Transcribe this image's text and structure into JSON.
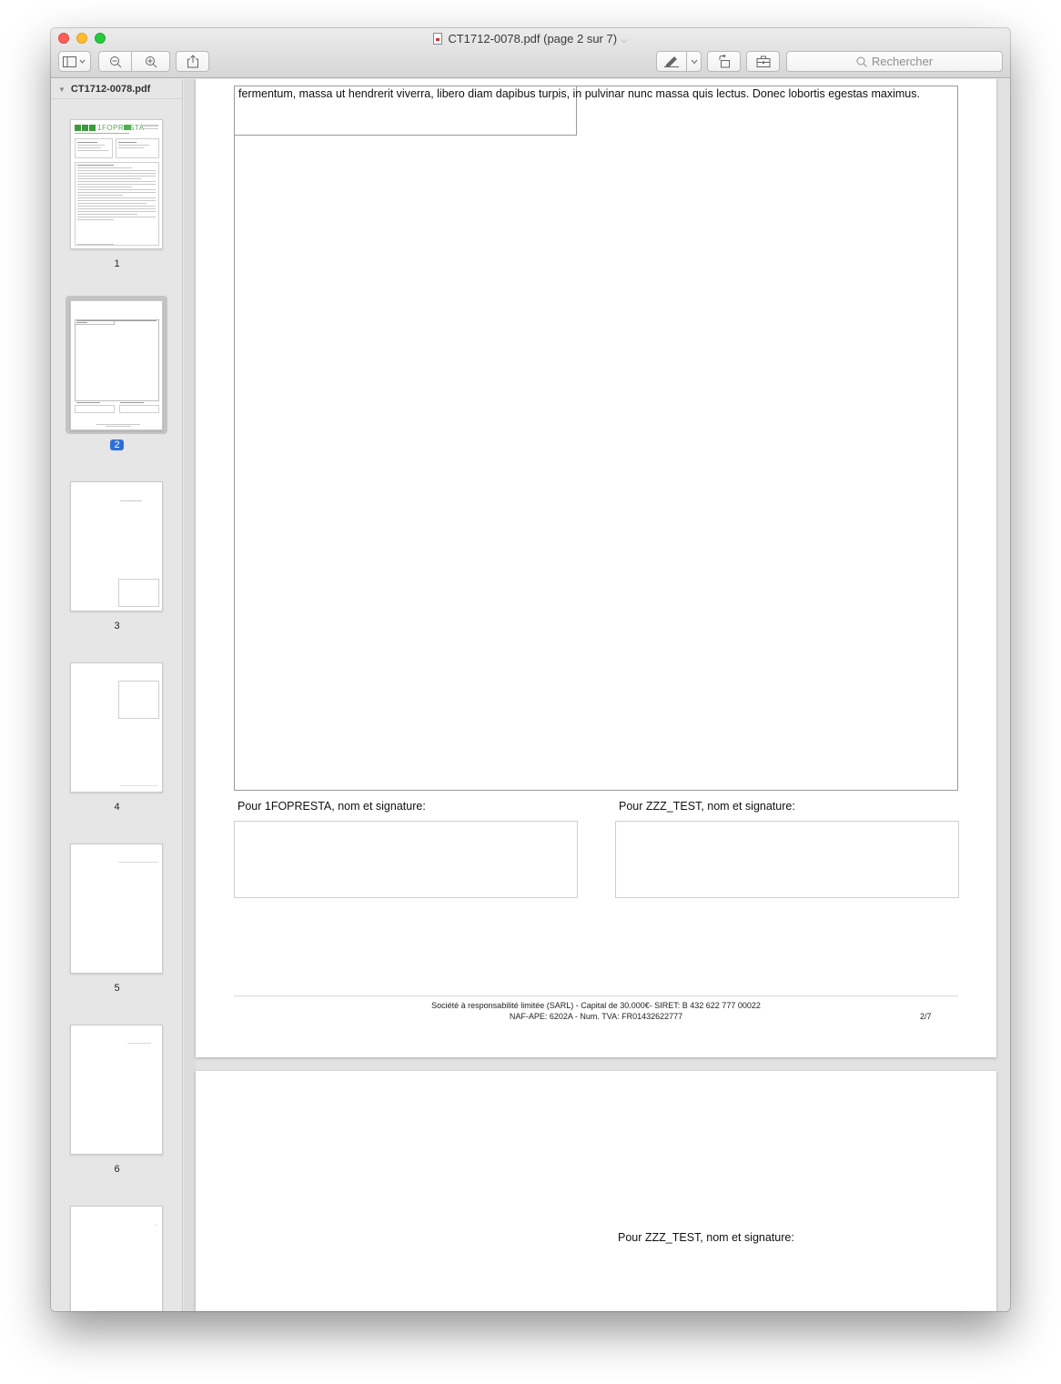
{
  "window": {
    "title": "CT1712-0078.pdf (page 2 sur 7)",
    "title_chevron": "⌵"
  },
  "toolbar": {
    "search_placeholder": "Rechercher",
    "buttons": [
      "sidebar-toggle",
      "zoom-out",
      "zoom-in",
      "share",
      "markup",
      "markup-menu",
      "rotate",
      "toolbox"
    ]
  },
  "sidebar": {
    "file_name": "CT1712-0078.pdf",
    "pages": [
      {
        "label": "1",
        "selected": false
      },
      {
        "label": "2",
        "selected": true
      },
      {
        "label": "3",
        "selected": false
      },
      {
        "label": "4",
        "selected": false
      },
      {
        "label": "5",
        "selected": false
      },
      {
        "label": "6",
        "selected": false
      },
      {
        "label": "",
        "selected": false
      }
    ],
    "thumb1_brand": "1FOPRESTA"
  },
  "document": {
    "paragraph": "fermentum, massa ut hendrerit viverra, libero diam dapibus turpis, in pulvinar nunc massa quis lectus. Donec lobortis egestas maximus.",
    "sig_left": "Pour 1FOPRESTA, nom et signature:",
    "sig_right": "Pour ZZZ_TEST, nom et signature:",
    "footer_line1": "Société à responsabilité limitée (SARL) - Capital de 30.000€- SIRET: B 432 622 777 00022",
    "footer_line2": "NAF-APE: 6202A - Num. TVA: FR01432622777",
    "page_number": "2/7",
    "next_page_sig": "Pour ZZZ_TEST, nom et signature:"
  },
  "colors": {
    "selection": "#2f6fd7",
    "close": "#fc5f57",
    "minimize": "#fdbc2e",
    "maximize": "#28c840"
  }
}
